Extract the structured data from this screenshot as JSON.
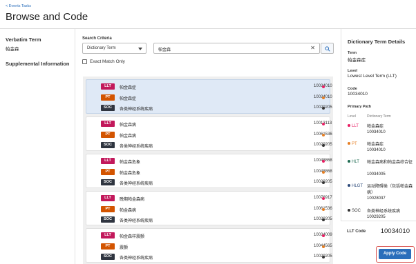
{
  "header": {
    "back_link": "< Events Tasks",
    "title": "Browse and Code"
  },
  "left_panel": {
    "verbatim_heading": "Verbatim Term",
    "verbatim_value": "帕金森",
    "supplemental_heading": "Supplemental Information"
  },
  "search": {
    "criteria_label": "Search Criteria",
    "criteria_selected": "Dictionary Term",
    "query_value": "帕金森",
    "exact_match_label": "Exact Match Only",
    "exact_match_checked": false
  },
  "results": [
    {
      "selected": true,
      "rows": [
        {
          "level": "LLT",
          "term": "帕金森症",
          "code": "10034010",
          "dot_color": "#e91e63"
        },
        {
          "level": "PT",
          "term": "帕金森症",
          "code": "10034010",
          "dot_color": "#e67e22"
        },
        {
          "level": "SOC",
          "term": "各类神经系统疾病",
          "code": "10029205",
          "dot_color": "#333333"
        }
      ]
    },
    {
      "selected": false,
      "rows": [
        {
          "level": "LLT",
          "term": "帕金森病",
          "code": "10013113",
          "dot_color": "#e91e63"
        },
        {
          "level": "PT",
          "term": "帕金森病",
          "code": "10061536",
          "dot_color": "#e67e22"
        },
        {
          "level": "SOC",
          "term": "各类神经系统疾病",
          "code": "10029205",
          "dot_color": "#333333"
        }
      ]
    },
    {
      "selected": false,
      "rows": [
        {
          "level": "LLT",
          "term": "帕金森危象",
          "code": "10048868",
          "dot_color": "#e91e63"
        },
        {
          "level": "PT",
          "term": "帕金森危象",
          "code": "10048868",
          "dot_color": "#e67e22"
        },
        {
          "level": "SOC",
          "term": "各类神经系统疾病",
          "code": "10029205",
          "dot_color": "#333333"
        }
      ]
    },
    {
      "selected": false,
      "rows": [
        {
          "level": "LLT",
          "term": "晚期帕金森病",
          "code": "10076917",
          "dot_color": "#e91e63"
        },
        {
          "level": "PT",
          "term": "帕金森病",
          "code": "10061536",
          "dot_color": "#e67e22"
        },
        {
          "level": "SOC",
          "term": "各类神经系统疾病",
          "code": "10029205",
          "dot_color": "#333333"
        }
      ]
    },
    {
      "selected": false,
      "rows": [
        {
          "level": "LLT",
          "term": "帕金森样震颤",
          "code": "10034009",
          "dot_color": "#e91e63"
        },
        {
          "level": "PT",
          "term": "震颤",
          "code": "10044565",
          "dot_color": "#e67e22"
        },
        {
          "level": "SOC",
          "term": "各类神经系统疾病",
          "code": "10029205",
          "dot_color": "#333333"
        }
      ]
    }
  ],
  "details": {
    "title": "Dictionary Term Details",
    "term_label": "Term",
    "term_value": "帕金森症",
    "level_label": "Level",
    "level_value": "Lowest Level Term (LLT)",
    "code_label": "Code",
    "code_value": "10034010",
    "primary_path_label": "Primary Path",
    "col_level": "Level",
    "col_term": "Dictionary Term",
    "path": [
      {
        "level": "LLT",
        "name": "帕金森症",
        "code": "10034010",
        "color": "#e91e63"
      },
      {
        "level": "PT",
        "name": "帕金森症",
        "code": "10034010",
        "color": "#e67e22"
      },
      {
        "level": "HLT",
        "name": "帕金森病和帕金森综合征",
        "code": "10034005",
        "color": "#1e6b52"
      },
      {
        "level": "HLGT",
        "name": "运动障碍类（包括帕金森病）",
        "code": "10028037",
        "color": "#2c4a7a"
      },
      {
        "level": "SOC",
        "name": "各类神经系统疾病",
        "code": "10029205",
        "color": "#333333"
      }
    ]
  },
  "footer": {
    "llt_code_label": "LLT Code",
    "llt_code_value": "10034010",
    "apply_label": "Apply Code"
  }
}
